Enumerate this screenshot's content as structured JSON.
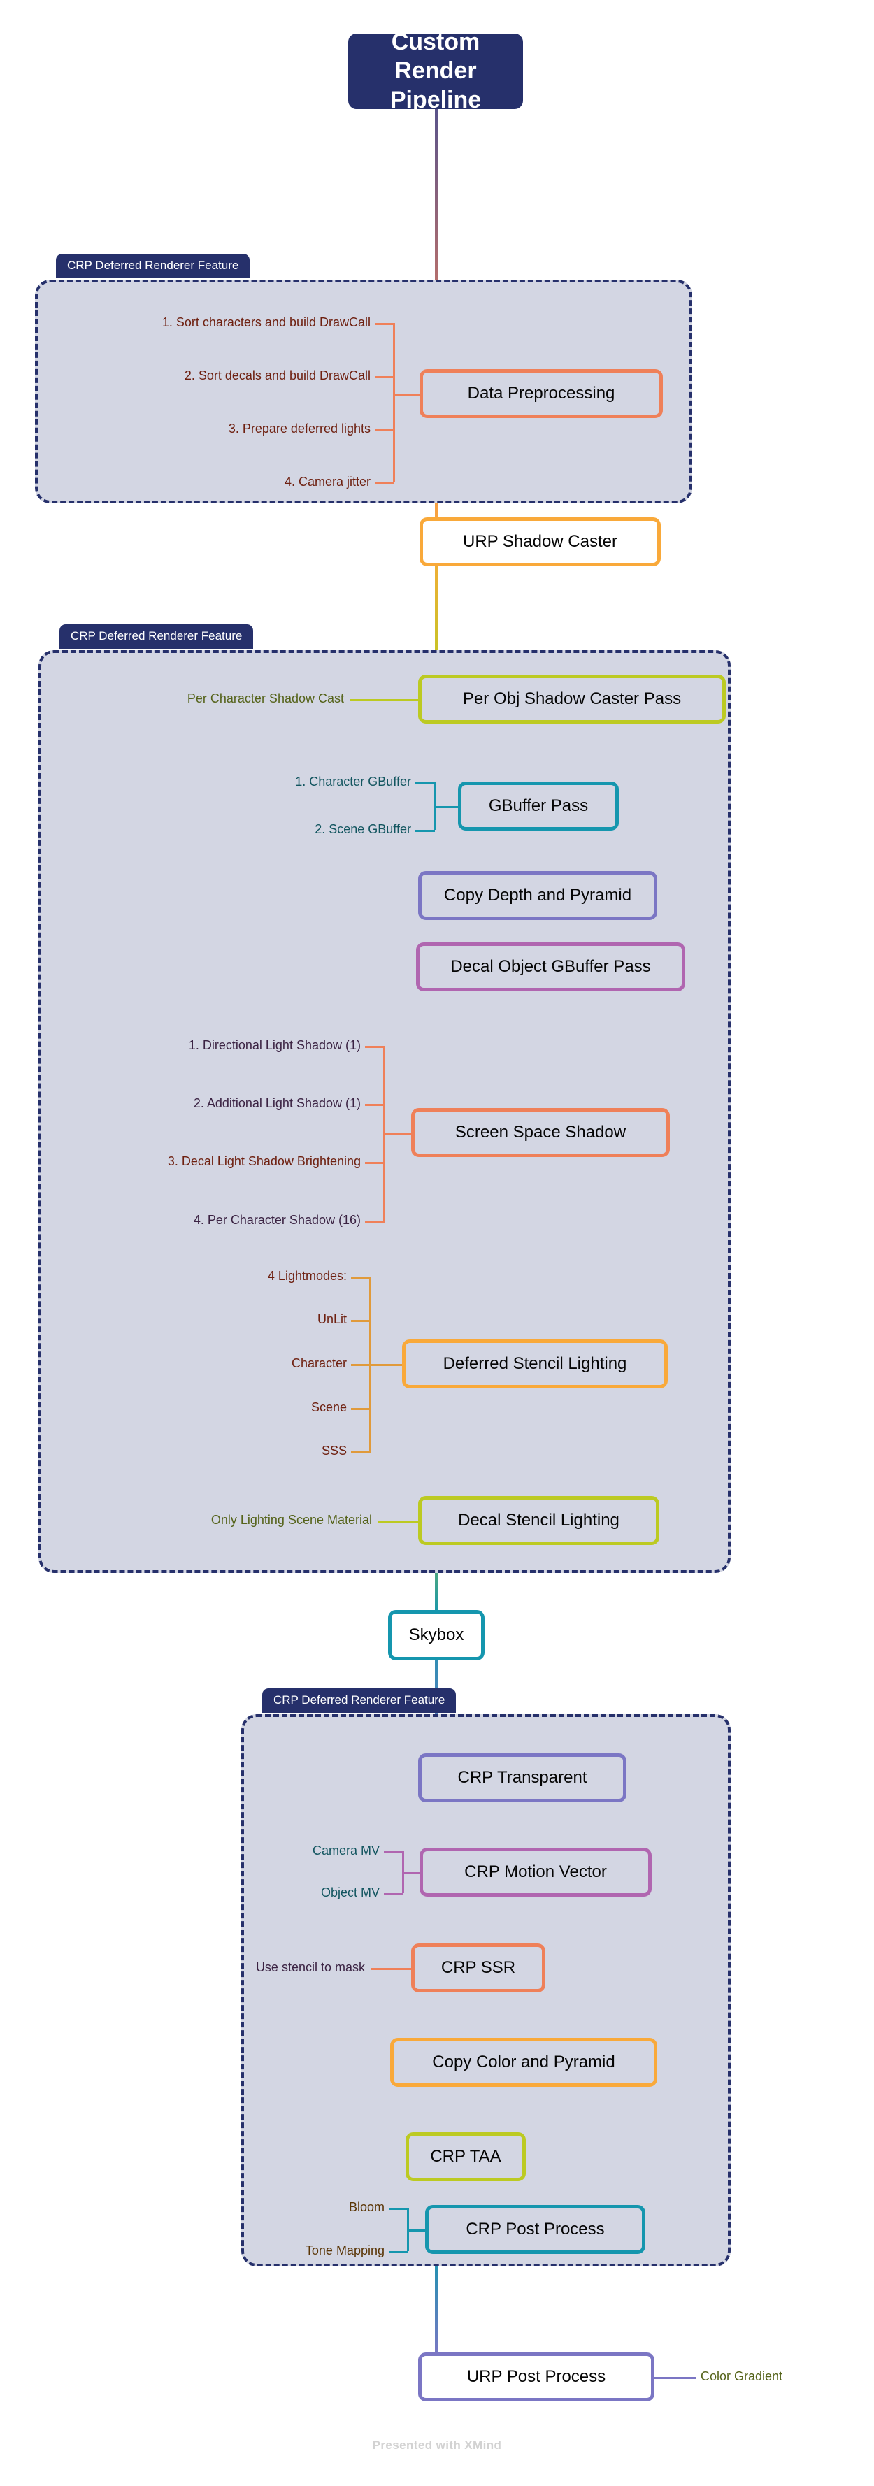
{
  "title": {
    "text": "Custom Render Pipeline"
  },
  "footer": {
    "text": "Presented with XMind"
  },
  "groups": [
    {
      "id": "g1",
      "label": "CRP Deferred Renderer Feature"
    },
    {
      "id": "g2",
      "label": "CRP Deferred Renderer Feature"
    },
    {
      "id": "g3",
      "label": "CRP Deferred Renderer Feature"
    }
  ],
  "nodes": {
    "data_preprocessing": {
      "label": "Data Preprocessing",
      "color": "#ef8059"
    },
    "urp_shadow_caster": {
      "label": "URP Shadow Caster",
      "color": "#f9a93a"
    },
    "per_obj_shadow_caster_pass": {
      "label": "Per Obj Shadow Caster Pass",
      "color": "#bcca22"
    },
    "gbuffer_pass": {
      "label": "GBuffer Pass",
      "color": "#1596ae"
    },
    "copy_depth_and_pyramid": {
      "label": "Copy Depth and Pyramid",
      "color": "#7b76c4"
    },
    "decal_object_gbuffer_pass": {
      "label": "Decal Object GBuffer Pass",
      "color": "#b066b0"
    },
    "screen_space_shadow": {
      "label": "Screen Space Shadow",
      "color": "#ef8059"
    },
    "deferred_stencil_lighting": {
      "label": "Deferred Stencil Lighting",
      "color": "#f9a93a"
    },
    "decal_stencil_lighting": {
      "label": "Decal Stencil Lighting",
      "color": "#bcca22"
    },
    "skybox": {
      "label": "Skybox",
      "color": "#1596ae"
    },
    "crp_transparent": {
      "label": "CRP Transparent",
      "color": "#7b76c4"
    },
    "crp_motion_vector": {
      "label": "CRP Motion Vector",
      "color": "#b066b0"
    },
    "crp_ssr": {
      "label": "CRP SSR",
      "color": "#ef8059"
    },
    "copy_color_and_pyramid": {
      "label": "Copy Color and Pyramid",
      "color": "#f9a93a"
    },
    "crp_taa": {
      "label": "CRP TAA",
      "color": "#bcca22"
    },
    "crp_post_process": {
      "label": "CRP Post Process",
      "color": "#1596ae"
    },
    "urp_post_process": {
      "label": "URP Post Process",
      "color": "#7b76c4"
    }
  },
  "branches": {
    "data_preprocessing": [
      {
        "text": "1. Sort characters and build DrawCall",
        "color": "#6e2010"
      },
      {
        "text": "2. Sort decals and build DrawCall",
        "color": "#6e2010"
      },
      {
        "text": "3. Prepare deferred lights",
        "color": "#6e2010"
      },
      {
        "text": "4. Camera jitter",
        "color": "#6e2010"
      }
    ],
    "per_obj_shadow_caster_pass": [
      {
        "text": "Per Character Shadow Cast",
        "color": "#55631a"
      }
    ],
    "gbuffer_pass": [
      {
        "text": "1. Character GBuffer",
        "color": "#12555f"
      },
      {
        "text": "2. Scene GBuffer",
        "color": "#12555f"
      }
    ],
    "screen_space_shadow": [
      {
        "text": "1. Directional Light Shadow (1)",
        "color": "#3b2343"
      },
      {
        "text": "2. Additional Light Shadow (1)",
        "color": "#3b2343"
      },
      {
        "text": "3. Decal Light Shadow Brightening",
        "color": "#6e2010"
      },
      {
        "text": "4. Per Character Shadow (16)",
        "color": "#3b2343"
      }
    ],
    "deferred_stencil_lighting": [
      {
        "text": "4 Lightmodes:",
        "color": "#6e2010"
      },
      {
        "text": "UnLit",
        "color": "#6e2010"
      },
      {
        "text": "Character",
        "color": "#6e2010"
      },
      {
        "text": "Scene",
        "color": "#6e2010"
      },
      {
        "text": "SSS",
        "color": "#6e2010"
      }
    ],
    "decal_stencil_lighting": [
      {
        "text": "Only Lighting Scene Material",
        "color": "#55631a"
      }
    ],
    "crp_motion_vector": [
      {
        "text": "Camera MV",
        "color": "#12555f"
      },
      {
        "text": "Object MV",
        "color": "#12555f"
      }
    ],
    "crp_ssr": [
      {
        "text": "Use stencil to mask",
        "color": "#3b2343"
      }
    ],
    "crp_post_process": [
      {
        "text": "Bloom",
        "color": "#5a3505"
      },
      {
        "text": "Tone Mapping",
        "color": "#5a3505"
      }
    ],
    "urp_post_process": [
      {
        "text": "Color Gradient",
        "color": "#55631a"
      }
    ]
  }
}
